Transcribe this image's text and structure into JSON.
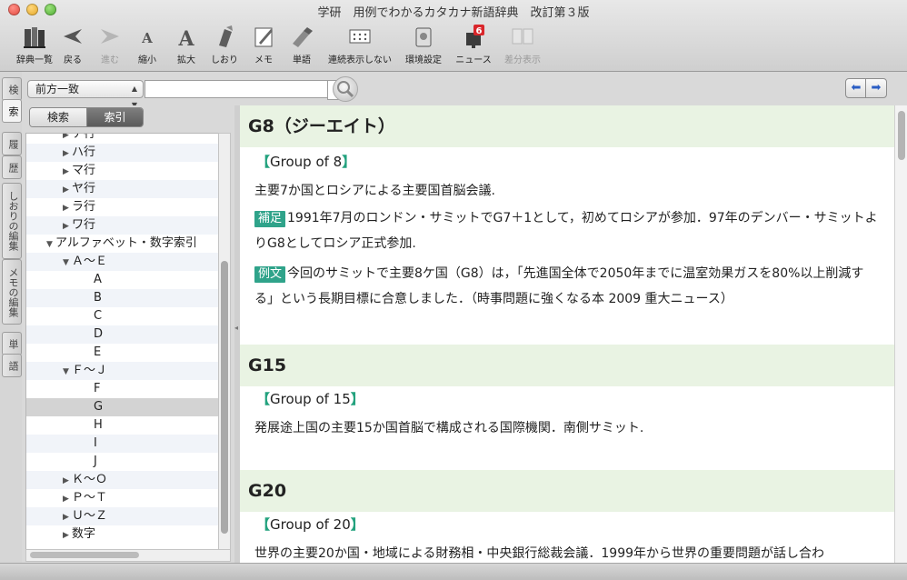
{
  "window": {
    "title": "学研　用例でわかるカタカナ新語辞典　改訂第３版"
  },
  "toolbar": {
    "items": [
      {
        "label": "辞典一覧",
        "icon": "books-icon",
        "enabled": true
      },
      {
        "label": "戻る",
        "icon": "back-arrow-icon",
        "enabled": true
      },
      {
        "label": "進む",
        "icon": "forward-arrow-icon",
        "enabled": false
      },
      {
        "label": "縮小",
        "icon": "font-smaller-icon",
        "enabled": true
      },
      {
        "label": "拡大",
        "icon": "font-larger-icon",
        "enabled": true
      },
      {
        "label": "しおり",
        "icon": "bookmark-icon",
        "enabled": true
      },
      {
        "label": "メモ",
        "icon": "memo-icon",
        "enabled": true
      },
      {
        "label": "単語",
        "icon": "word-icon",
        "enabled": true
      },
      {
        "label": "連続表示しない",
        "icon": "continuous-view-icon",
        "enabled": true
      },
      {
        "label": "環境設定",
        "icon": "preferences-icon",
        "enabled": true
      },
      {
        "label": "ニュース",
        "icon": "news-mailbox-icon",
        "enabled": true,
        "badge": "6"
      },
      {
        "label": "差分表示",
        "icon": "diff-view-icon",
        "enabled": false
      }
    ]
  },
  "side_tabs": [
    "検",
    "索",
    "履",
    "歴",
    "しおりの編集",
    "メモの編集",
    "単",
    "語"
  ],
  "search": {
    "mode": "前方一致",
    "query": ""
  },
  "left_panel": {
    "segments": [
      "検索",
      "索引"
    ],
    "active_segment": "索引",
    "tree": [
      {
        "label": "ナ行",
        "depth": 1,
        "twisty": "▶"
      },
      {
        "label": "ハ行",
        "depth": 1,
        "twisty": "▶"
      },
      {
        "label": "マ行",
        "depth": 1,
        "twisty": "▶"
      },
      {
        "label": "ヤ行",
        "depth": 1,
        "twisty": "▶"
      },
      {
        "label": "ラ行",
        "depth": 1,
        "twisty": "▶"
      },
      {
        "label": "ワ行",
        "depth": 1,
        "twisty": "▶"
      },
      {
        "label": "アルファベット・数字索引",
        "depth": 0,
        "twisty": "▼"
      },
      {
        "label": "Ａ～Ｅ",
        "depth": 1,
        "twisty": "▼"
      },
      {
        "label": "A",
        "depth": 2,
        "twisty": ""
      },
      {
        "label": "B",
        "depth": 2,
        "twisty": ""
      },
      {
        "label": "C",
        "depth": 2,
        "twisty": ""
      },
      {
        "label": "D",
        "depth": 2,
        "twisty": ""
      },
      {
        "label": "E",
        "depth": 2,
        "twisty": ""
      },
      {
        "label": "Ｆ～Ｊ",
        "depth": 1,
        "twisty": "▼"
      },
      {
        "label": "F",
        "depth": 2,
        "twisty": ""
      },
      {
        "label": "G",
        "depth": 2,
        "twisty": "",
        "selected": true
      },
      {
        "label": "H",
        "depth": 2,
        "twisty": ""
      },
      {
        "label": "I",
        "depth": 2,
        "twisty": ""
      },
      {
        "label": "J",
        "depth": 2,
        "twisty": ""
      },
      {
        "label": "Ｋ～Ｏ",
        "depth": 1,
        "twisty": "▶"
      },
      {
        "label": "Ｐ～Ｔ",
        "depth": 1,
        "twisty": "▶"
      },
      {
        "label": "Ｕ～Ｚ",
        "depth": 1,
        "twisty": "▶"
      },
      {
        "label": "数字",
        "depth": 1,
        "twisty": "▶"
      }
    ]
  },
  "entries": [
    {
      "headword": "G8（ジーエイト）",
      "english": "Group of 8",
      "definition": "主要7か国とロシアによる主要国首脳会議.",
      "supplement_tag": "補足",
      "supplement": "1991年7月のロンドン・サミットでG7＋1として，初めてロシアが参加．97年のデンバー・サミットよりG8としてロシア正式参加.",
      "example_tag": "例文",
      "example": "今回のサミットで主要8ケ国（G8）は，「先進国全体で2050年までに温室効果ガスを80%以上削減する」という長期目標に合意しました．（時事問題に強くなる本 2009 重大ニュース）"
    },
    {
      "headword": "G15",
      "english": "Group of 15",
      "definition": "発展途上国の主要15か国首脳で構成される国際機関．南側サミット."
    },
    {
      "headword": "G20",
      "english": "Group of 20",
      "definition": "世界の主要20か国・地域による財務相・中央銀行総裁会議．1999年から世界の重要問題が話し合わ"
    }
  ],
  "colors": {
    "entry_header_bg": "#e9f3e3",
    "bracket": "#23a27e",
    "tag_bg": "#2fa38a"
  }
}
